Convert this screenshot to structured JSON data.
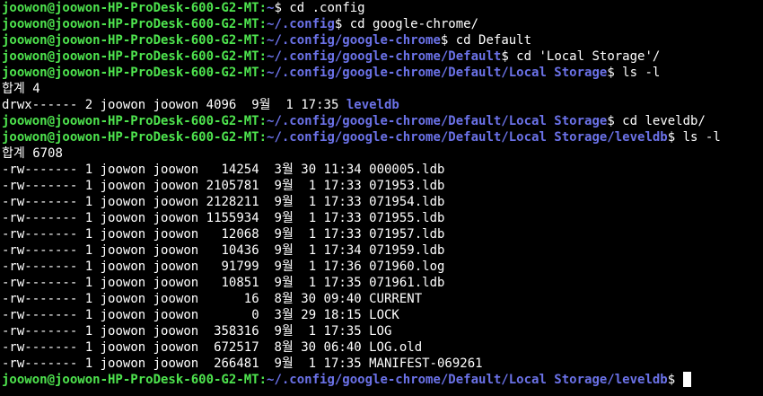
{
  "terminal": {
    "prompt_user": "joowon@joowon-HP-ProDesk-600-G2-MT",
    "colors": {
      "background": "#000000",
      "text": "#ffffff",
      "prompt_user": "#4ee44e",
      "prompt_path": "#6b72e8",
      "directory": "#6b72e8"
    },
    "commands": [
      {
        "path": "~",
        "sep": "$ ",
        "command": "cd .config"
      },
      {
        "path": "~/.config",
        "sep": "$ ",
        "command": "cd google-chrome/"
      },
      {
        "path": "~/.config/google-chrome",
        "sep": "$ ",
        "command": "cd Default"
      },
      {
        "path": "~/.config/google-chrome/Default",
        "sep": "$ ",
        "command": "cd 'Local Storage'/"
      },
      {
        "path": "~/.config/google-chrome/Default/Local Storage",
        "sep": "$ ",
        "command": "ls -l"
      }
    ],
    "total1": "합계 4",
    "dir_entry": {
      "perms": "drwx------",
      "links": "2",
      "owner": "joowon",
      "group": "joowon",
      "size": "4096",
      "date": " 9월  1 17:35",
      "name": "leveldb"
    },
    "commands2": [
      {
        "path": "~/.config/google-chrome/Default/Local Storage",
        "sep": "$ ",
        "command": "cd leveldb/"
      },
      {
        "path": "~/.config/google-chrome/Default/Local Storage/leveldb",
        "sep": "$ ",
        "command": "ls -l"
      }
    ],
    "total2": "합계 6708",
    "files": [
      {
        "perms": "-rw-------",
        "links": "1",
        "owner": "joowon",
        "group": "joowon",
        "size": "14254",
        "date": " 3월 30 11:34",
        "name": "000005.ldb"
      },
      {
        "perms": "-rw-------",
        "links": "1",
        "owner": "joowon",
        "group": "joowon",
        "size": "2105781",
        "date": " 9월  1 17:33",
        "name": "071953.ldb"
      },
      {
        "perms": "-rw-------",
        "links": "1",
        "owner": "joowon",
        "group": "joowon",
        "size": "2128211",
        "date": " 9월  1 17:33",
        "name": "071954.ldb"
      },
      {
        "perms": "-rw-------",
        "links": "1",
        "owner": "joowon",
        "group": "joowon",
        "size": "1155934",
        "date": " 9월  1 17:33",
        "name": "071955.ldb"
      },
      {
        "perms": "-rw-------",
        "links": "1",
        "owner": "joowon",
        "group": "joowon",
        "size": "12068",
        "date": " 9월  1 17:33",
        "name": "071957.ldb"
      },
      {
        "perms": "-rw-------",
        "links": "1",
        "owner": "joowon",
        "group": "joowon",
        "size": "10436",
        "date": " 9월  1 17:34",
        "name": "071959.ldb"
      },
      {
        "perms": "-rw-------",
        "links": "1",
        "owner": "joowon",
        "group": "joowon",
        "size": "91799",
        "date": " 9월  1 17:36",
        "name": "071960.log"
      },
      {
        "perms": "-rw-------",
        "links": "1",
        "owner": "joowon",
        "group": "joowon",
        "size": "10851",
        "date": " 9월  1 17:35",
        "name": "071961.ldb"
      },
      {
        "perms": "-rw-------",
        "links": "1",
        "owner": "joowon",
        "group": "joowon",
        "size": "16",
        "date": " 8월 30 09:40",
        "name": "CURRENT"
      },
      {
        "perms": "-rw-------",
        "links": "1",
        "owner": "joowon",
        "group": "joowon",
        "size": "0",
        "date": " 3월 29 18:15",
        "name": "LOCK"
      },
      {
        "perms": "-rw-------",
        "links": "1",
        "owner": "joowon",
        "group": "joowon",
        "size": "358316",
        "date": " 9월  1 17:35",
        "name": "LOG"
      },
      {
        "perms": "-rw-------",
        "links": "1",
        "owner": "joowon",
        "group": "joowon",
        "size": "672517",
        "date": " 8월 30 06:40",
        "name": "LOG.old"
      },
      {
        "perms": "-rw-------",
        "links": "1",
        "owner": "joowon",
        "group": "joowon",
        "size": "266481",
        "date": " 9월  1 17:35",
        "name": "MANIFEST-069261"
      }
    ],
    "final_prompt": {
      "path": "~/.config/google-chrome/Default/Local Storage/leveldb",
      "sep": "$ "
    }
  }
}
